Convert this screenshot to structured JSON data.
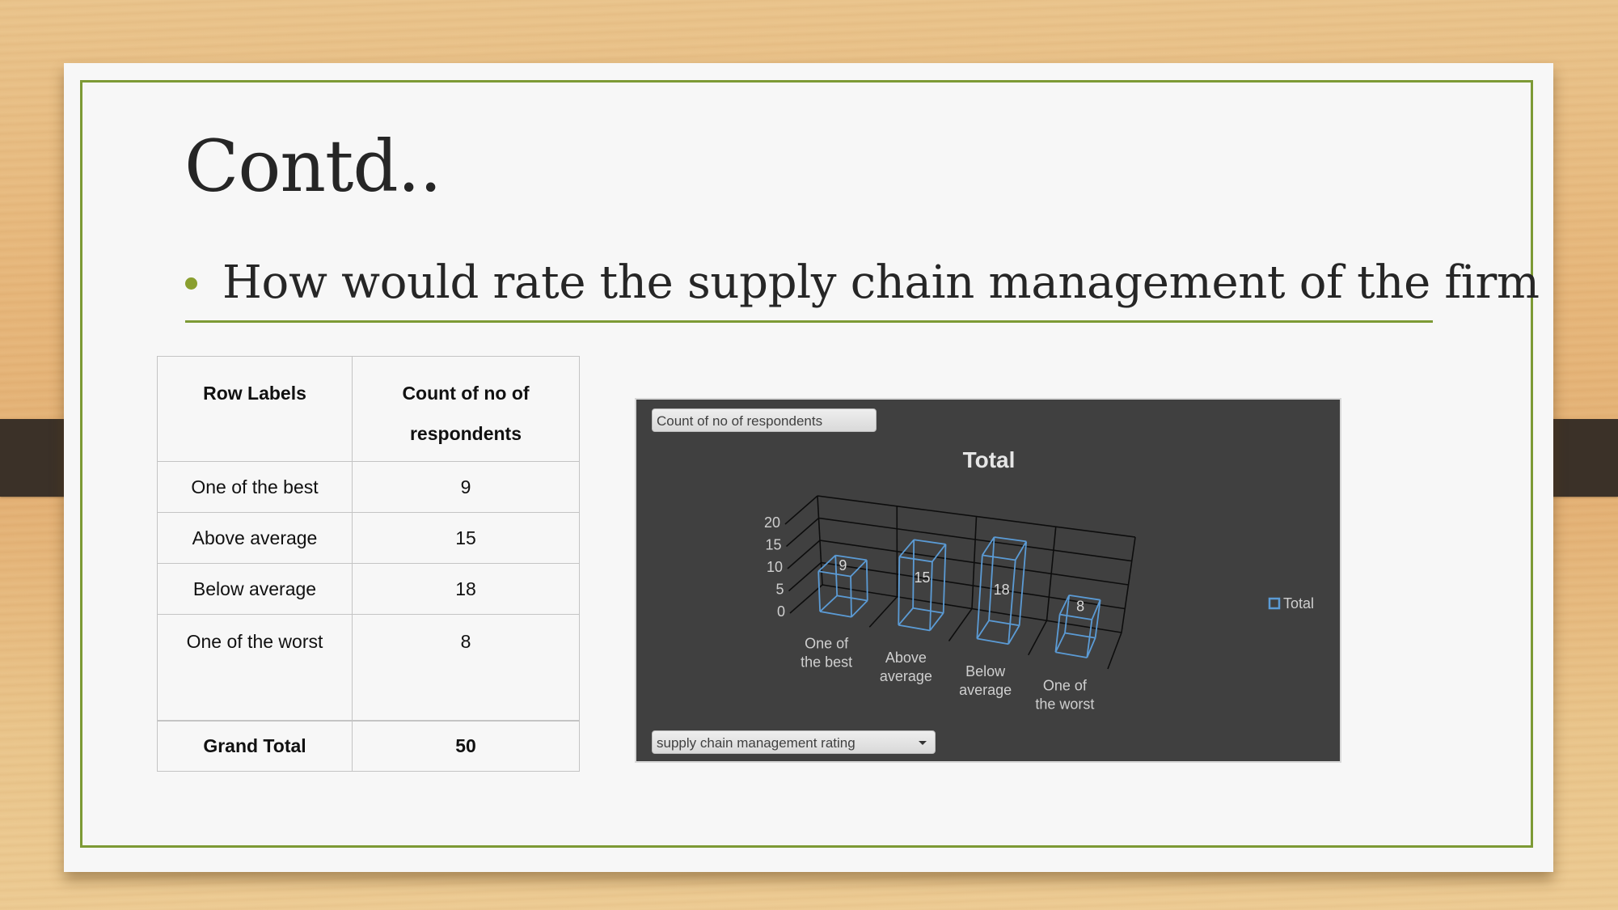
{
  "slide": {
    "title": "Contd..",
    "bullet": "How would rate the supply chain management of the firm"
  },
  "table": {
    "headers": [
      "Row Labels",
      "Count of no of respondents"
    ],
    "header_col2_lines": [
      "Count of no of",
      "respondents"
    ],
    "rows": [
      {
        "label": "One of the best",
        "value": "9"
      },
      {
        "label": "Above average",
        "value": "15"
      },
      {
        "label": "Below average",
        "value": "18"
      },
      {
        "label": "One of the worst",
        "value": "8"
      }
    ],
    "total": {
      "label": "Grand Total",
      "value": "50"
    }
  },
  "pivot_chart": {
    "value_field_button": "Count of no of respondents",
    "axis_field_button": "supply chain management rating",
    "bar_color": "#5b9bd5"
  },
  "chart_data": {
    "type": "bar",
    "style": "3d-column-wireframe",
    "title": "Total",
    "categories": [
      "One of the best",
      "Above average",
      "Below average",
      "One of the worst"
    ],
    "category_lines": [
      [
        "One of",
        "the best"
      ],
      [
        "Above",
        "average"
      ],
      [
        "Below",
        "average"
      ],
      [
        "One of",
        "the worst"
      ]
    ],
    "series": [
      {
        "name": "Total",
        "values": [
          9,
          15,
          18,
          8
        ]
      }
    ],
    "data_labels": [
      "9",
      "15",
      "18",
      "8"
    ],
    "yticks": [
      0,
      5,
      10,
      15,
      20
    ],
    "ylim": [
      0,
      20
    ],
    "xlabel": "",
    "ylabel": "",
    "grid": true,
    "legend": {
      "position": "right",
      "entries": [
        "Total"
      ]
    }
  }
}
